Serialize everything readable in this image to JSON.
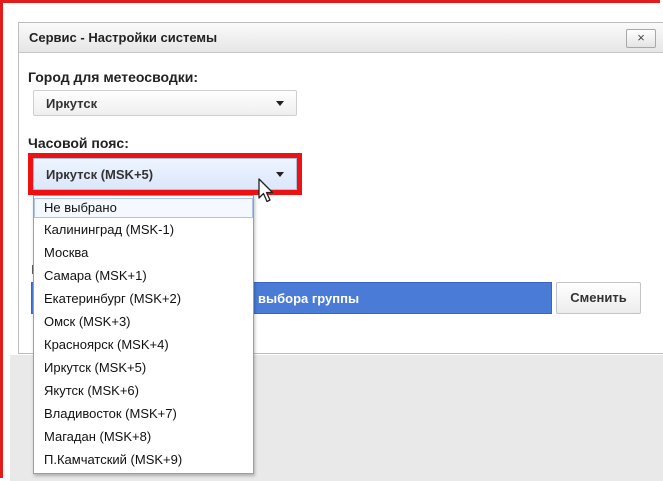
{
  "dialog": {
    "title": "Сервис - Настройки системы",
    "close_label": "×"
  },
  "weather_city": {
    "label": "Город для метеосводки:",
    "value": "Иркутск"
  },
  "timezone": {
    "label": "Часовой пояс:",
    "value": "Иркутск (MSK+5)",
    "options": [
      "Не выбрано",
      "Калининград (MSK-1)",
      "Москва",
      "Самара (MSK+1)",
      "Екатеринбург (MSK+2)",
      "Омск (MSK+3)",
      "Красноярск (MSK+4)",
      "Иркутск (MSK+5)",
      "Якутск (MSK+6)",
      "Владивосток (MSK+7)",
      "Магадан (MSK+8)",
      "П.Камчатский (MSK+9)"
    ]
  },
  "group": {
    "label_stub": "I",
    "bar_text": "выбора группы",
    "change_button": "Сменить"
  },
  "colors": {
    "highlight": "#ee1111",
    "frame": "#e31b1b",
    "bar": "#4a7bd6"
  },
  "icons": {
    "close": "close-icon",
    "caret": "caret-down-icon",
    "cursor": "mouse-pointer-icon"
  }
}
